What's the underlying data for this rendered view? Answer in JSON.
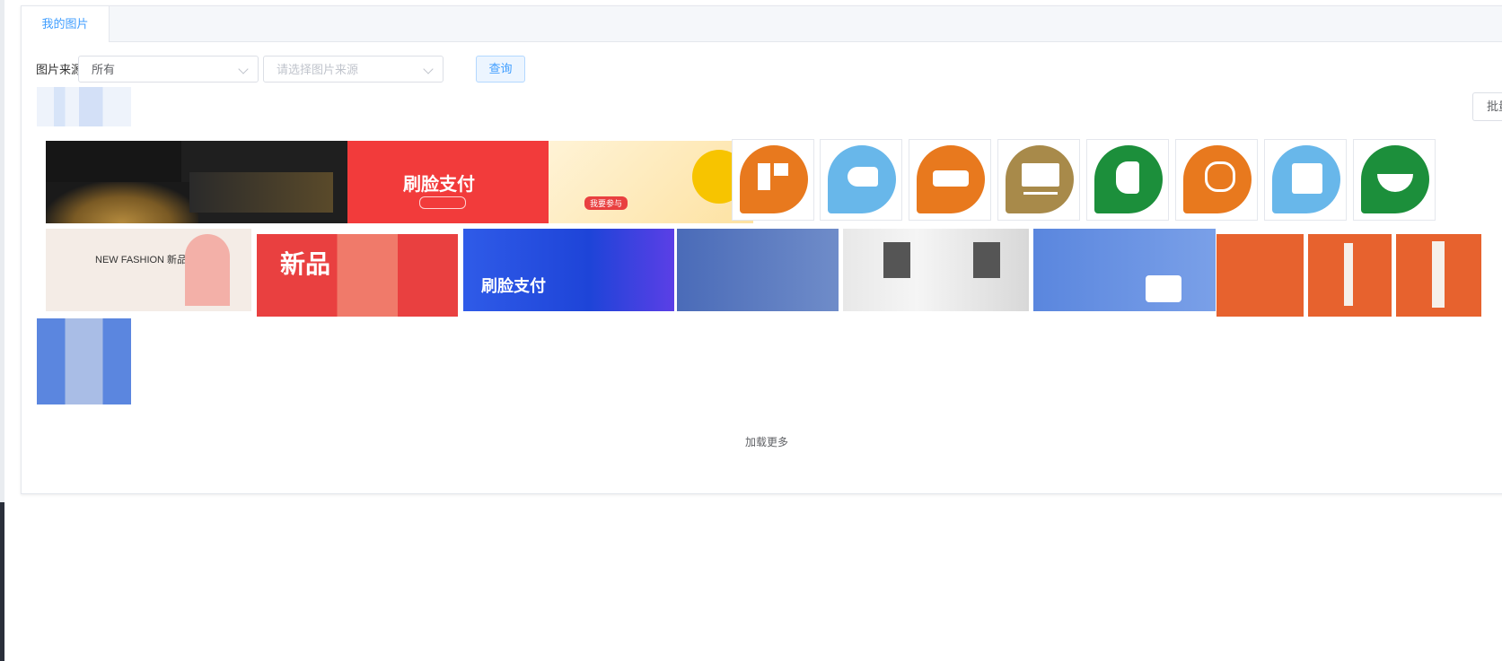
{
  "tabs": [
    {
      "label": "我的图片",
      "active": true
    }
  ],
  "filter": {
    "label": "图片来源",
    "source_select_value": "所有",
    "sub_source_placeholder": "请选择图片来源",
    "query_label": "查询"
  },
  "toolbar": {
    "batch_label": "批量"
  },
  "banners": [
    {
      "text": "",
      "bg": "#1a1a1a"
    },
    {
      "text": "刷脸支付",
      "bg": "#f23b3b"
    },
    {
      "text": "我要参与",
      "bg": "#fde7b0"
    },
    {
      "text": "NEW FASHION 新品·上市",
      "bg": "#f4ece6"
    },
    {
      "text": "新品",
      "bg": "#e94040"
    },
    {
      "text": "刷脸支付",
      "bg": "#2f5be8"
    }
  ],
  "icon_tiles": [
    {
      "icon": "grid-icon",
      "color": "#e8791e"
    },
    {
      "icon": "horse-icon",
      "color": "#68b7ea"
    },
    {
      "icon": "sofa-icon",
      "color": "#e8791e"
    },
    {
      "icon": "monitor-icon",
      "color": "#a88a4a"
    },
    {
      "icon": "tissue-icon",
      "color": "#1c8f3b"
    },
    {
      "icon": "toilet-icon",
      "color": "#e8791e"
    },
    {
      "icon": "shirt-icon",
      "color": "#68b7ea"
    },
    {
      "icon": "bowl-icon",
      "color": "#1c8f3b"
    }
  ],
  "load_more_label": "加载更多"
}
